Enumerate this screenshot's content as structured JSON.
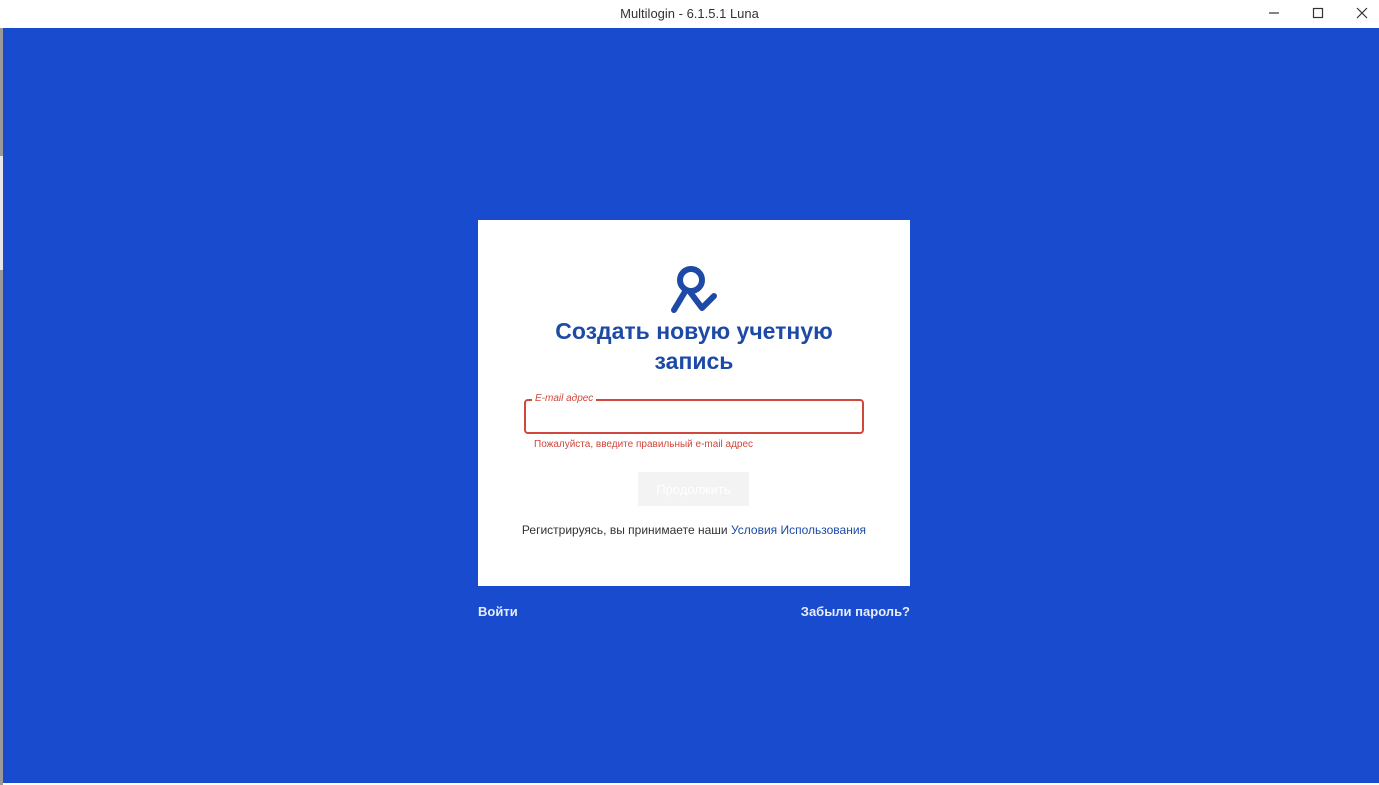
{
  "window": {
    "title": "Multilogin - 6.1.5.1 Luna",
    "controls": [
      "minimize-icon",
      "maximize-icon",
      "close-icon"
    ]
  },
  "colors": {
    "background": "#194bce",
    "heading": "#1d4aa6",
    "error": "#d0473d",
    "link": "#1d4aa6"
  },
  "card": {
    "logo_icon": "multilogin-logo-icon",
    "heading": "Создать новую учетную запись",
    "email_field": {
      "label": "E-mail адрес",
      "value": "",
      "error": "Пожалуйста, введите правильный e-mail адрес"
    },
    "continue_button": "Продолжить",
    "terms_text": "Регистрируясь, вы принимаете наши",
    "terms_link": "Условия Использования"
  },
  "footer": {
    "login_link": "Войти",
    "forgot_link": "Забыли пароль?"
  }
}
